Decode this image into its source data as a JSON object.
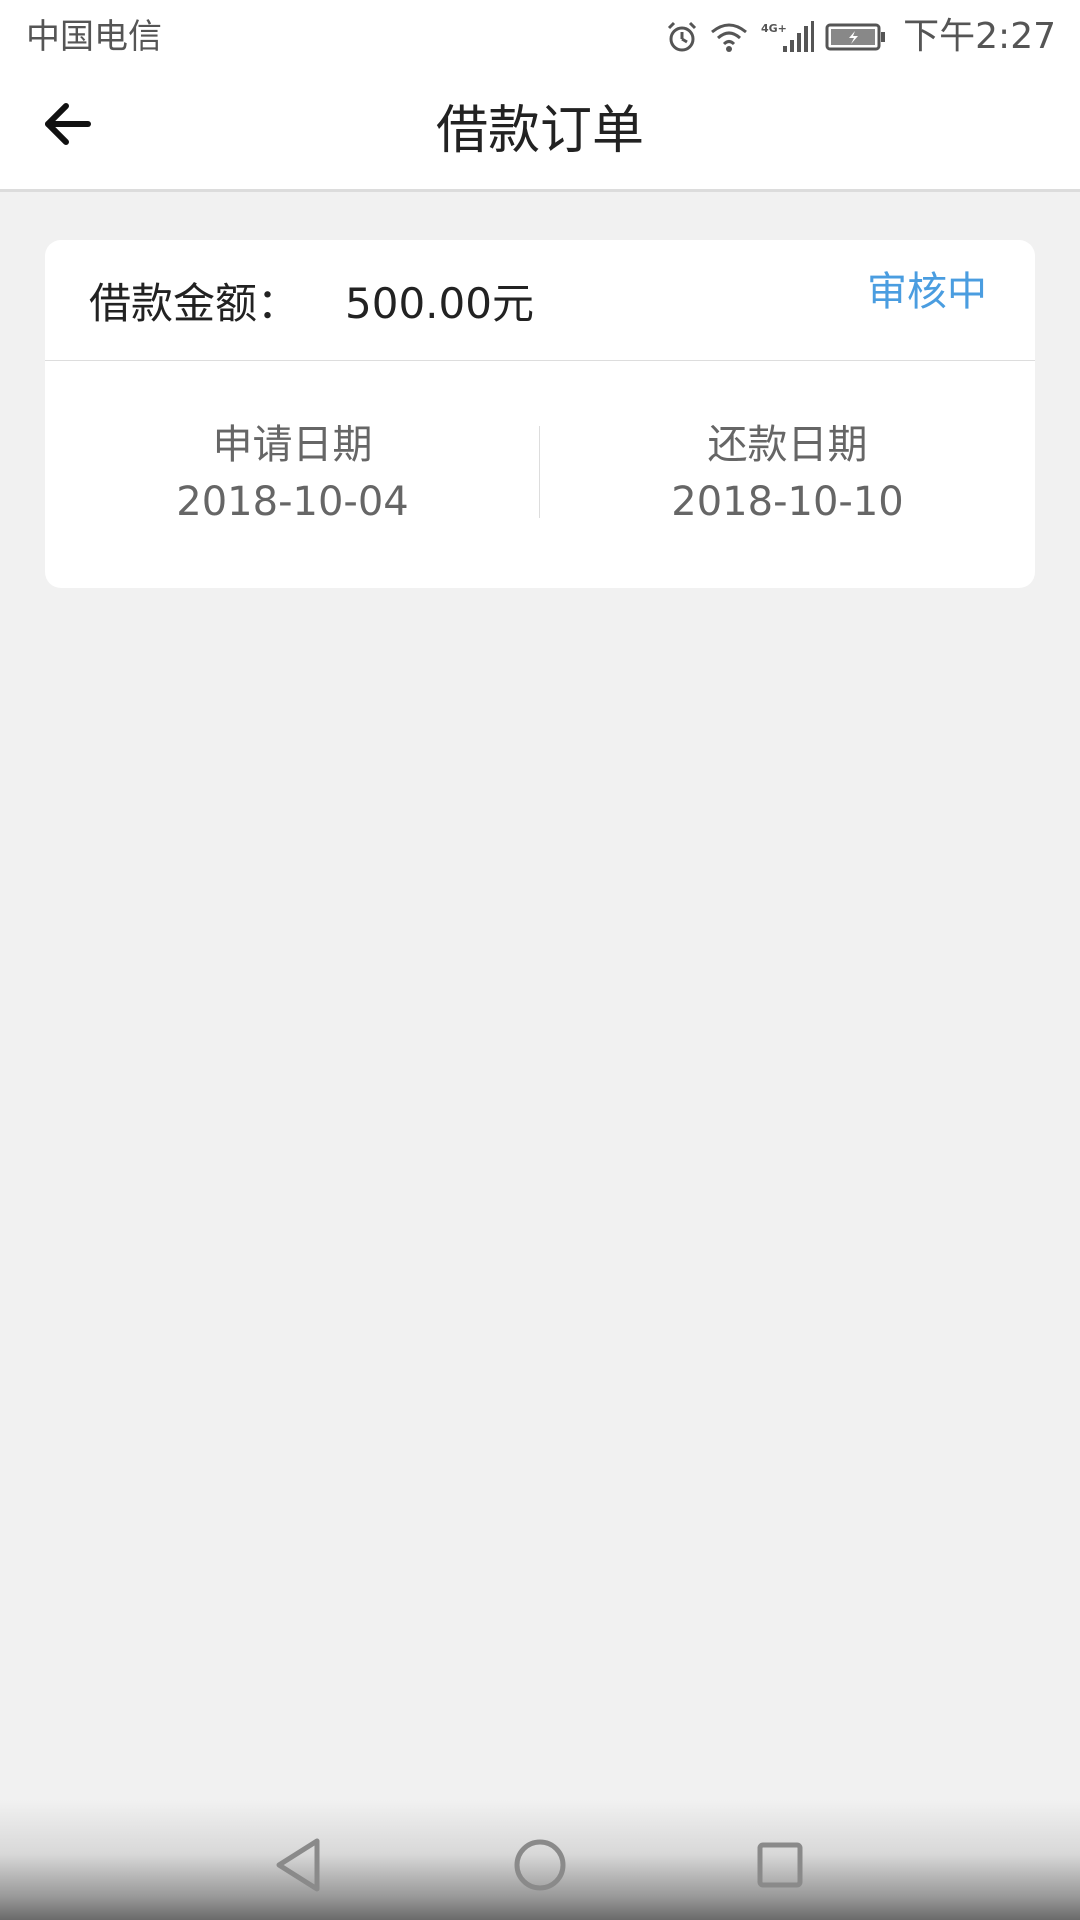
{
  "status_bar": {
    "carrier": "中国电信",
    "time": "下午2:27",
    "icons": [
      "alarm-icon",
      "wifi-icon",
      "signal-4g-icon",
      "battery-icon"
    ],
    "network_label": "4G+"
  },
  "header": {
    "title": "借款订单",
    "back_icon": "arrow-left-icon"
  },
  "order": {
    "amount_label": "借款金额：",
    "amount_value": "500.00元",
    "status": "审核中",
    "apply_date_label": "申请日期",
    "apply_date": "2018-10-04",
    "repay_date_label": "还款日期",
    "repay_date": "2018-10-10"
  },
  "nav_bar": {
    "icons": [
      "nav-back-icon",
      "nav-home-icon",
      "nav-recents-icon"
    ]
  },
  "colors": {
    "background": "#f1f1f1",
    "card": "#ffffff",
    "status_accent": "#4a9de0",
    "text_primary": "#222222",
    "text_secondary": "#666666"
  }
}
